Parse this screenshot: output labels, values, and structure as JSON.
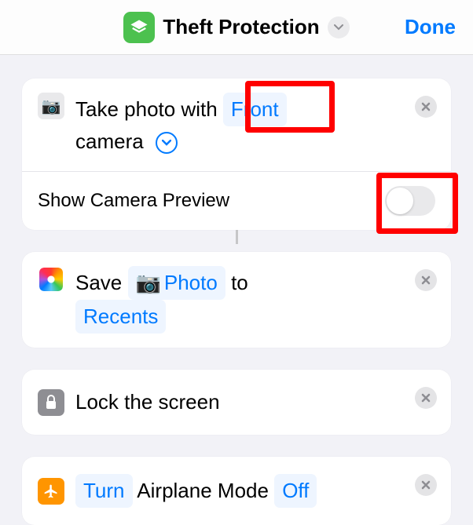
{
  "header": {
    "title": "Theft Protection",
    "done_label": "Done"
  },
  "cards": {
    "take_photo": {
      "text_prefix": "Take photo with",
      "camera_token": "Front",
      "text_suffix": "camera",
      "option_label": "Show Camera Preview",
      "option_value": false
    },
    "save_photo": {
      "text_prefix": "Save",
      "photo_token": "Photo",
      "text_mid": "to",
      "recents_token": "Recents"
    },
    "lock_screen": {
      "text": "Lock the screen"
    },
    "airplane": {
      "turn_token": "Turn",
      "text_mid": "Airplane Mode",
      "off_token": "Off"
    }
  }
}
